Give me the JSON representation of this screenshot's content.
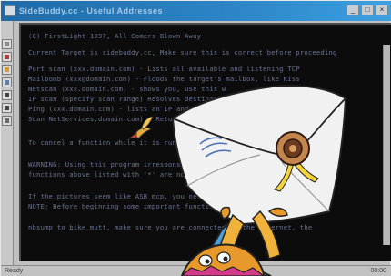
{
  "window": {
    "title": "SideBuddy.cc - Useful Addresses",
    "controls": [
      "_",
      "□",
      "×"
    ]
  },
  "toolbar": {
    "tools": [
      "tool-1",
      "tool-2",
      "tool-3",
      "tool-4",
      "tool-5",
      "tool-6",
      "tool-7"
    ]
  },
  "terminal": {
    "lines": [
      "(C) FirstLight 1997, All Comers Blown Away",
      "Current Target is sidebuddy.cc, Make sure this is correct before proceeding",
      "Port scan (xxx.domain.com) - Lists all available and listening TCP",
      "Mailbomb (xxx@domain.com) - Floods the target's mailbox, like Kiss",
      "                 Netscan (xxx.domain.com) - shows you, use this w",
      "  IP scan (specify scan range)  Resolves destinations for servers",
      "          Ping (xxx.domain.com) - lists an IP and anything",
      "Scan NetServices.domain.com)  -  Return nothing",
      "To cancel a function while it is running, press Ctrl+C",
      "WARNING: Using this program irresponsibly is not the fault",
      "functions above listed with '*' are not fully developed",
      "If the pictures seem like ASB mcp, you need to do a bit solving",
      "NOTE: Before beginning some important functions, double check on the",
      "nbsump to bike mutt, make sure you are connected to the Internet, the"
    ]
  },
  "statusbar": {
    "left": "Ready",
    "right": "00:00"
  },
  "colors": {
    "background": "#2f6e9b",
    "terminal_bg": "#0c0c0c",
    "terminal_text": "#7a84a8",
    "envelope": "#f1f1f1",
    "seal": "#c4864d",
    "creature_orange": "#e79a2b",
    "creature_shirt": "#4aa0d8"
  },
  "icons": [
    "envelope-illustration",
    "wax-seal-icon",
    "ribbon-icon",
    "creature-illustration",
    "bird-illustration"
  ]
}
